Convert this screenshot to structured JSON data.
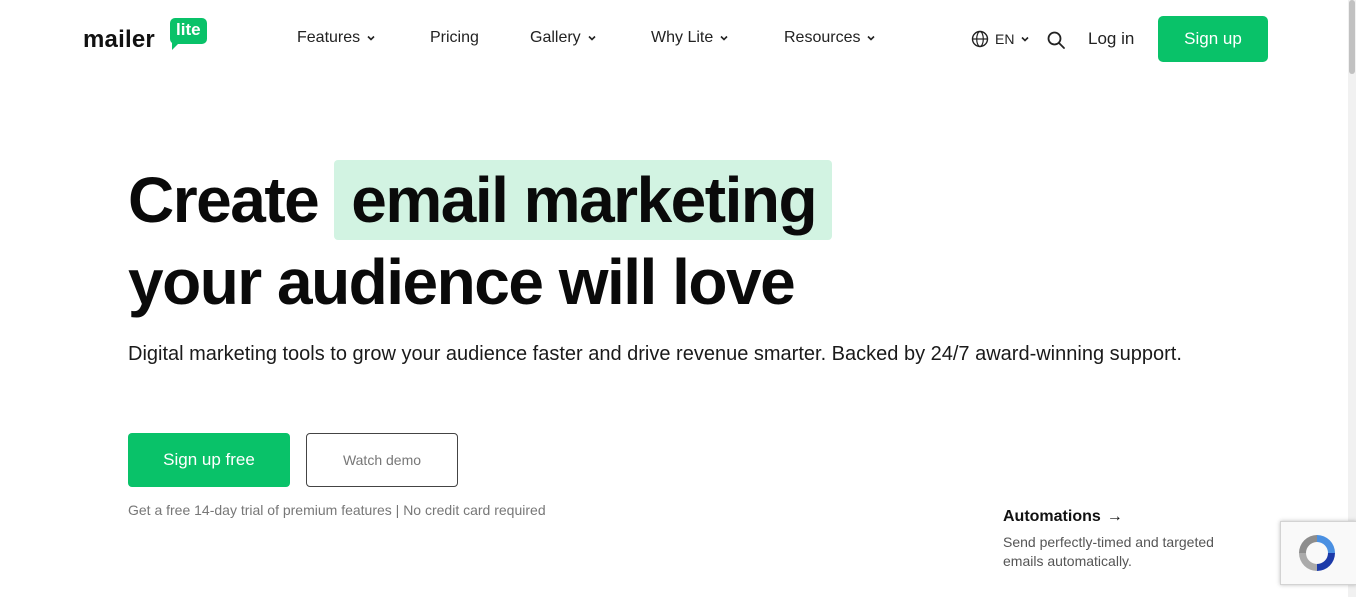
{
  "header": {
    "logo": {
      "text": "mailer",
      "badge": "lite"
    },
    "nav": [
      {
        "label": "Features",
        "has_dropdown": true
      },
      {
        "label": "Pricing",
        "has_dropdown": false
      },
      {
        "label": "Gallery",
        "has_dropdown": true
      },
      {
        "label": "Why Lite",
        "has_dropdown": true
      },
      {
        "label": "Resources",
        "has_dropdown": true
      }
    ],
    "language": "EN",
    "login_label": "Log in",
    "signup_label": "Sign up",
    "icons": {
      "language": "globe-icon",
      "search": "search-icon"
    }
  },
  "hero": {
    "headline_start": "Create",
    "headline_highlight": "email marketing",
    "headline_line2": "your audience will love",
    "subtext": "Digital marketing tools to grow your audience faster and drive revenue smarter. Backed by 24/7 award-winning support.",
    "primary_cta": "Sign up free",
    "secondary_cta": "Watch demo",
    "trial_note": "Get a free 14-day trial of premium features | No credit card required"
  },
  "feature_card": {
    "title": "Automations",
    "arrow": "→",
    "description": "Send perfectly-timed and targeted emails automatically."
  },
  "colors": {
    "brand_green": "#09c269",
    "highlight_bg": "#d2f3e2",
    "text_dark": "#0a0a0a",
    "text_muted": "#777777"
  }
}
